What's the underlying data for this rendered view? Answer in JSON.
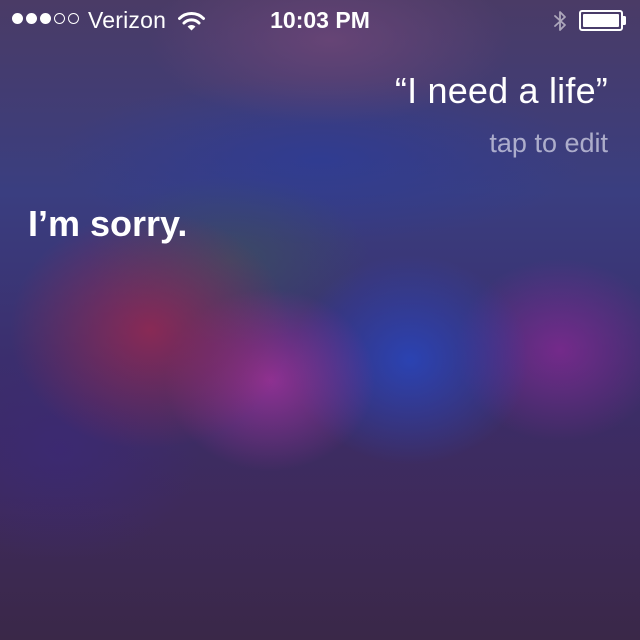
{
  "status_bar": {
    "signal_strength": {
      "filled": 3,
      "total": 5
    },
    "carrier": "Verizon",
    "time": "10:03 PM",
    "icons": [
      "wifi-icon",
      "bluetooth-icon",
      "battery-icon"
    ],
    "battery_level": 1.0
  },
  "conversation": {
    "user_query": "“I need a life”",
    "edit_hint": "tap to edit",
    "assistant_reply": "I’m sorry."
  }
}
